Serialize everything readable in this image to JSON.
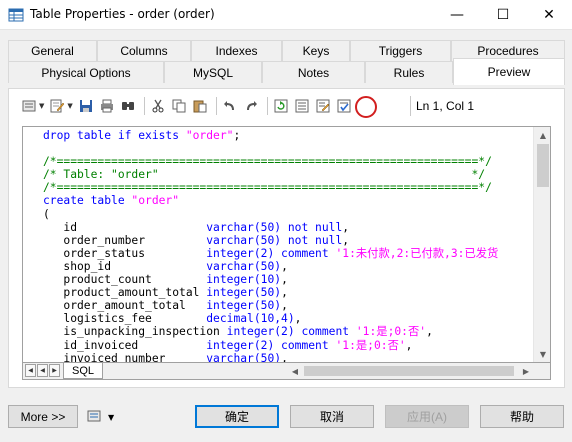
{
  "window": {
    "title": "Table Properties - order (order)",
    "minimize_glyph": "—",
    "maximize_glyph": "☐",
    "close_glyph": "✕"
  },
  "tabs": {
    "row1": [
      "General",
      "Columns",
      "Indexes",
      "Keys",
      "Triggers",
      "Procedures"
    ],
    "row2": [
      "Physical Options",
      "MySQL",
      "Notes",
      "Rules",
      "Preview"
    ],
    "active": "Preview"
  },
  "toolbar": {
    "icons": [
      "properties-icon",
      "edit-icon",
      "save-icon",
      "print-icon",
      "find-icon",
      "cut-icon",
      "copy-icon",
      "paste-icon",
      "undo-icon",
      "redo-icon",
      "refresh-icon",
      "show-generation-options-icon",
      "change-generation-options-icon",
      "select-generation-options-icon"
    ],
    "position_label": "Ln 1, Col 1",
    "highlight_color": "#d21f1f"
  },
  "editor": {
    "lines": [
      [
        {
          "t": "drop table if exists ",
          "c": "k"
        },
        {
          "t": "\"order\"",
          "c": "s"
        },
        {
          "t": ";",
          "c": ""
        }
      ],
      [
        {
          "t": "",
          "c": ""
        }
      ],
      [
        {
          "t": "/*==============================================================*/",
          "c": "c"
        }
      ],
      [
        {
          "t": "/* Table: \"order\"                                              */",
          "c": "c"
        }
      ],
      [
        {
          "t": "/*==============================================================*/",
          "c": "c"
        }
      ],
      [
        {
          "t": "create table ",
          "c": "k"
        },
        {
          "t": "\"order\"",
          "c": "s"
        }
      ],
      [
        {
          "t": "(",
          "c": ""
        }
      ],
      [
        {
          "t": "   id                   ",
          "c": ""
        },
        {
          "t": "varchar(50) not null",
          "c": "k"
        },
        {
          "t": ",",
          "c": ""
        }
      ],
      [
        {
          "t": "   order_number         ",
          "c": ""
        },
        {
          "t": "varchar(50) not null",
          "c": "k"
        },
        {
          "t": ",",
          "c": ""
        }
      ],
      [
        {
          "t": "   order_status         ",
          "c": ""
        },
        {
          "t": "integer(2) comment ",
          "c": "k"
        },
        {
          "t": "'1:未付款,2:已付款,3:已发货",
          "c": "s"
        }
      ],
      [
        {
          "t": "   shop_id              ",
          "c": ""
        },
        {
          "t": "varchar(50)",
          "c": "k"
        },
        {
          "t": ",",
          "c": ""
        }
      ],
      [
        {
          "t": "   product_count        ",
          "c": ""
        },
        {
          "t": "integer(10)",
          "c": "k"
        },
        {
          "t": ",",
          "c": ""
        }
      ],
      [
        {
          "t": "   product_amount_total ",
          "c": ""
        },
        {
          "t": "integer(50)",
          "c": "k"
        },
        {
          "t": ",",
          "c": ""
        }
      ],
      [
        {
          "t": "   order_amount_total   ",
          "c": ""
        },
        {
          "t": "integer(50)",
          "c": "k"
        },
        {
          "t": ",",
          "c": ""
        }
      ],
      [
        {
          "t": "   logistics_fee        ",
          "c": ""
        },
        {
          "t": "decimal(10,4)",
          "c": "k"
        },
        {
          "t": ",",
          "c": ""
        }
      ],
      [
        {
          "t": "   is_unpacking_inspection ",
          "c": ""
        },
        {
          "t": "integer(2) comment ",
          "c": "k"
        },
        {
          "t": "'1:是;0:否'",
          "c": "s"
        },
        {
          "t": ",",
          "c": ""
        }
      ],
      [
        {
          "t": "   id_invoiced          ",
          "c": ""
        },
        {
          "t": "integer(2) comment ",
          "c": "k"
        },
        {
          "t": "'1:是;0:否'",
          "c": "s"
        },
        {
          "t": ",",
          "c": ""
        }
      ],
      [
        {
          "t": "   invoiced_number      ",
          "c": ""
        },
        {
          "t": "varchar(50)",
          "c": "k"
        },
        {
          "t": ",",
          "c": ""
        }
      ]
    ]
  },
  "sql_tab": {
    "label": "SQL"
  },
  "buttons": {
    "more": "More >>",
    "ok": "确定",
    "cancel": "取消",
    "apply": "应用(A)",
    "help": "帮助"
  },
  "colors": {
    "keyword": "#0000ff",
    "string": "#ff00ff",
    "comment": "#008000",
    "default_button_border": "#0078d7"
  }
}
